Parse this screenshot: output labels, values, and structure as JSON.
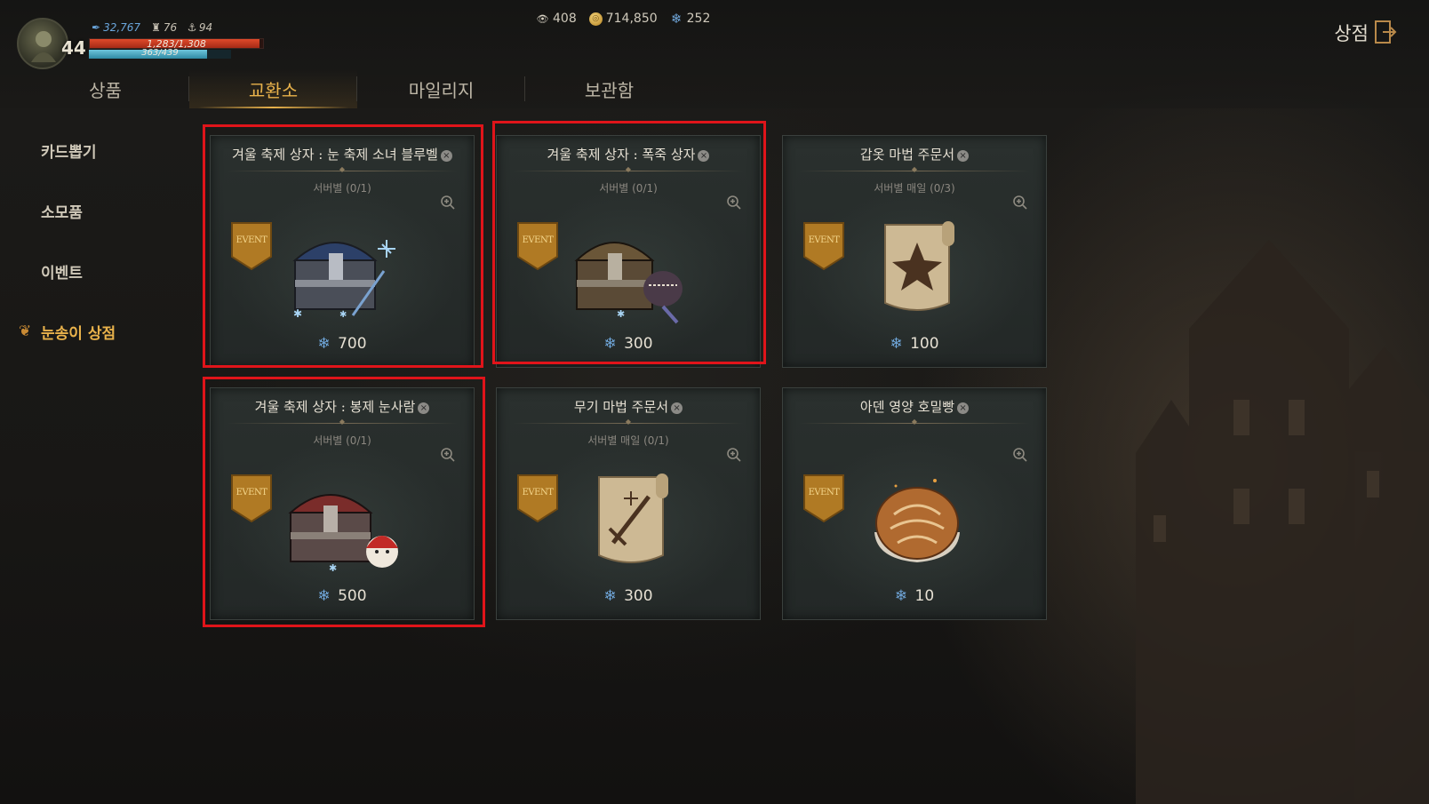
{
  "player": {
    "level": "44",
    "power": "32,767",
    "stat_a": "76",
    "stat_b": "94",
    "hp": "1,283/1,308",
    "hp_ratio": 0.98,
    "mp": "363/439",
    "mp_ratio": 0.83
  },
  "currencies": [
    {
      "icon": "eye-icon",
      "value": "408"
    },
    {
      "icon": "gold-coin-icon",
      "value": "714,850"
    },
    {
      "icon": "snowflake-icon",
      "value": "252"
    }
  ],
  "header": {
    "title": "상점"
  },
  "tabs": [
    {
      "label": "상품",
      "active": false
    },
    {
      "label": "교환소",
      "active": true
    },
    {
      "label": "마일리지",
      "active": false
    },
    {
      "label": "보관함",
      "active": false
    }
  ],
  "sidebar": {
    "items": [
      {
        "label": "카드뽑기",
        "active": false
      },
      {
        "label": "소모품",
        "active": false
      },
      {
        "label": "이벤트",
        "active": false
      },
      {
        "label": "눈송이 상점",
        "active": true
      }
    ]
  },
  "badge_label": "EVENT",
  "items": [
    {
      "title": "겨울 축제 상자 : 눈 축제 소녀 블루벨",
      "limit": "서버별 (0/1)",
      "price": "700",
      "art": "blue-chest",
      "highlighted": true
    },
    {
      "title": "겨울 축제 상자 : 폭죽 상자",
      "limit": "서버별 (0/1)",
      "price": "300",
      "art": "brown-chest",
      "highlighted": true
    },
    {
      "title": "갑옷 마법 주문서",
      "limit": "서버별 매일 (0/3)",
      "price": "100",
      "art": "armor-scroll",
      "highlighted": false
    },
    {
      "title": "겨울 축제 상자 : 봉제 눈사람",
      "limit": "서버별 (0/1)",
      "price": "500",
      "art": "red-chest",
      "highlighted": true
    },
    {
      "title": "무기 마법 주문서",
      "limit": "서버별 매일 (0/1)",
      "price": "300",
      "art": "weapon-scroll",
      "highlighted": false
    },
    {
      "title": "아덴 영양 호밀빵",
      "limit": "",
      "price": "10",
      "art": "bread",
      "highlighted": false
    }
  ],
  "colors": {
    "accent": "#e9b24b",
    "highlight": "#e0141a",
    "snow": "#6fa5d8"
  }
}
